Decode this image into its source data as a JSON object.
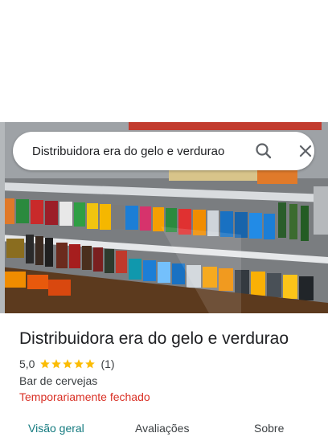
{
  "search": {
    "value": "Distribuidora era do gelo e verdurao",
    "search_icon": "search-icon",
    "close_icon": "close-icon"
  },
  "place": {
    "name": "Distribuidora era do gelo e verdurao",
    "rating": "5,0",
    "stars": 5,
    "review_count": "(1)",
    "category": "Bar de cervejas",
    "status": "Temporariamente fechado"
  },
  "tabs": [
    {
      "label": "Visão geral",
      "active": true
    },
    {
      "label": "Avaliações",
      "active": false
    },
    {
      "label": "Sobre",
      "active": false
    }
  ],
  "colors": {
    "status_closed": "#d93025",
    "active_tab": "#137a7f",
    "star": "#fbbc04"
  }
}
